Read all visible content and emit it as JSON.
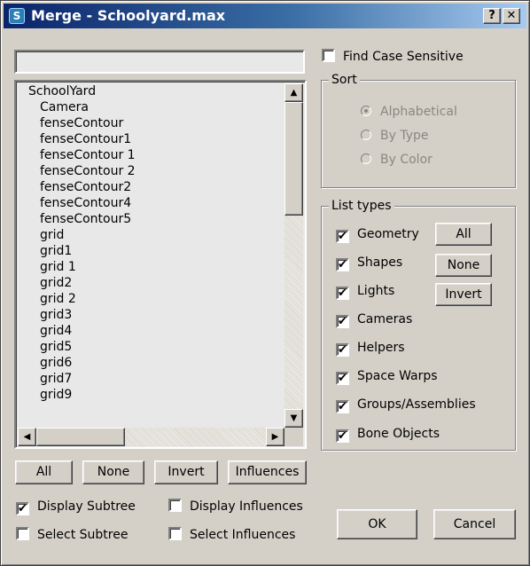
{
  "window": {
    "title": "Merge - Schoolyard.max",
    "help_button": "?",
    "close_button": "✕"
  },
  "search": {
    "value": ""
  },
  "tree": {
    "root": "SchoolYard",
    "items": [
      "Camera",
      "fenseContour",
      "fenseContour1",
      "fenseContour 1",
      "fenseContour 2",
      "fenseContour2",
      "fenseContour4",
      "fenseContour5",
      "grid",
      "grid1",
      "grid 1",
      "grid2",
      "grid 2",
      "grid3",
      "grid4",
      "grid5",
      "grid6",
      "grid7",
      "grid9"
    ]
  },
  "scrollbar": {
    "up": "▲",
    "down": "▼",
    "left": "◀",
    "right": "▶"
  },
  "find_case_sensitive": {
    "label": "Find Case Sensitive",
    "checked": false
  },
  "sort": {
    "label": "Sort",
    "options": [
      {
        "label": "Alphabetical",
        "selected": true
      },
      {
        "label": "By Type",
        "selected": false
      },
      {
        "label": "By Color",
        "selected": false
      }
    ]
  },
  "list_types": {
    "label": "List types",
    "items": [
      {
        "label": "Geometry",
        "checked": true
      },
      {
        "label": "Shapes",
        "checked": true
      },
      {
        "label": "Lights",
        "checked": true
      },
      {
        "label": "Cameras",
        "checked": true
      },
      {
        "label": "Helpers",
        "checked": true
      },
      {
        "label": "Space Warps",
        "checked": true
      },
      {
        "label": "Groups/Assemblies",
        "checked": true
      },
      {
        "label": "Bone Objects",
        "checked": true
      }
    ],
    "all_button": "All",
    "none_button": "None",
    "invert_button": "Invert"
  },
  "bottom_buttons": {
    "all": "All",
    "none": "None",
    "invert": "Invert",
    "influences": "Influences"
  },
  "options": {
    "display_subtree": {
      "label": "Display Subtree",
      "checked": true
    },
    "select_subtree": {
      "label": "Select Subtree",
      "checked": false
    },
    "display_influences": {
      "label": "Display Influences",
      "checked": false
    },
    "select_influences": {
      "label": "Select Influences",
      "checked": false
    }
  },
  "dialog_buttons": {
    "ok": "OK",
    "cancel": "Cancel"
  }
}
